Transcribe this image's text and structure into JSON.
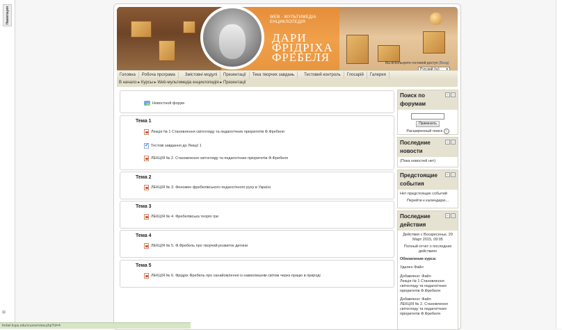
{
  "sidebar_tab": "Навигация",
  "left_footer": "⊞",
  "banner": {
    "subtitle_line1": "WEB - МУЛЬТИМЕДІА",
    "subtitle_line2": "ЕНЦИКЛОПЕДІЯ",
    "title_line1": "ДАРИ",
    "title_line2": "ФРІДРІХА",
    "title_line3": "ФРЕБЕЛЯ",
    "guest_text": "Вы используете гостевой доступ",
    "login_link": "(Вход)",
    "language": "Русский (ru)"
  },
  "menu": [
    "Головна",
    "Робоча програма",
    "Змістовні модулі",
    "Презентації",
    "Тека творчих завдань",
    "Тестовий контроль",
    "Глосарій",
    "Галерея"
  ],
  "breadcrumb": "В начало ▸ Курсы ▸ Web-мультимедіа енциклопедія ▸ Презентації",
  "sections": {
    "forum": "Новостной форум",
    "s1": {
      "title": "Тема 1",
      "a1": "Лекція № 1 Становлення світогляду та педагогічних пріоритетів Ф.Фребеля",
      "a2": "Тестові завдання до Лекції 1",
      "a3": "ЛЕКЦІЯ № 2. Становлення світогляду та педагогічних пріоритетів Ф.Фребеля"
    },
    "s2": {
      "title": "Тема 2",
      "a1": "ЛЕКЦІЯ № 3. Феномен фребелівського педагогічного руху в Україні"
    },
    "s3": {
      "title": "Тема 3",
      "a1": "ЛЕКЦІЯ № 4. Фребелівська теорія гри"
    },
    "s4": {
      "title": "Тема 4",
      "a1": "ЛЕКЦІЯ № 5. Ф.Фребель про творчий розвиток дитини"
    },
    "s5": {
      "title": "Тема 5",
      "a1": "ЛЕКЦІЯ № 6. Фрідріх Фребель про ознайомлення із навколишнім світом через працю в природі"
    }
  },
  "blocks": {
    "search": {
      "title": "Поиск по форумам",
      "button": "Применить",
      "advanced": "Расширенный поиск"
    },
    "news": {
      "title": "Последние новости",
      "empty": "(Пока новостей нет)"
    },
    "events": {
      "title": "Предстоящие события",
      "none": "Нет предстоящих событий",
      "calendar": "Перейти к календарю..."
    },
    "activity": {
      "title": "Последние действия",
      "since": "Действия с Воскресенье, 29 Март 2015, 09:05",
      "full_report": "Полный отчет о последних действиях",
      "updates_heading": "Обновление курса:",
      "u1": "Удален Файл",
      "u2_label": "Добавлено: Файл",
      "u2": "Лекція № 1 Становлення світогляду та педагогічних пріоритетів Ф.Фребеля",
      "u3_label": "Добавлено: Файл",
      "u3": "ЛЕКЦІЯ № 2. Становлення світогляду та педагогічних пріоритетів Ф.Фребеля"
    }
  },
  "status_url": "frebel.kspu.edu/course/view.php?id=4"
}
